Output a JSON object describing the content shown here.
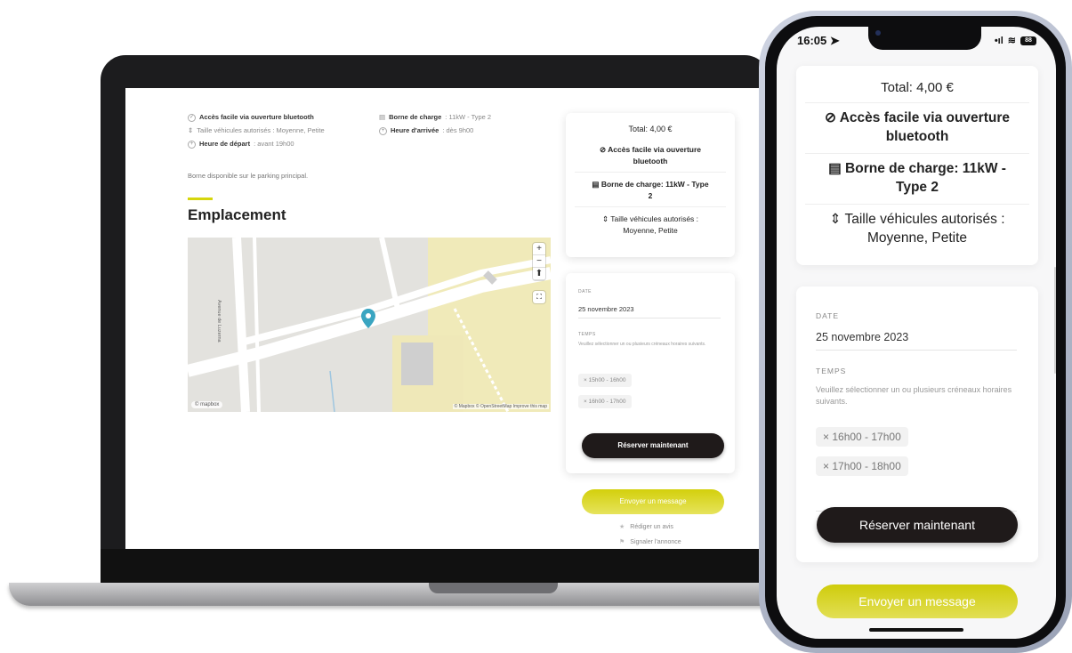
{
  "laptop": {
    "features": {
      "bluetooth": "Accès facile via ouverture bluetooth",
      "vehicle_size": "Taille véhicules autorisés : Moyenne, Petite",
      "departure_label": "Heure de départ",
      "departure_value": " : avant 19h00",
      "charging_label": "Borne de charge",
      "charging_value": ": 11kW - Type 2",
      "arrival_label": "Heure d'arrivée",
      "arrival_value": " : dès 9h00"
    },
    "description": "Borne disponible sur le parking principal.",
    "section_title": "Emplacement",
    "map": {
      "zoom_in": "+",
      "zoom_out": "−",
      "compass": "⬆",
      "fullscreen": "⛶",
      "street_label": "Avenue de Luzerna",
      "attribution": "© Mapbox © OpenStreetMap Improve this map",
      "logo": "© mapbox"
    },
    "summary": {
      "total": "Total: 4,00 €",
      "bluetooth": "⊘ Accès facile via ouverture bluetooth",
      "charging": "Borne de charge: 11kW - Type 2",
      "vehicle_size": "⇕ Taille véhicules autorisés : Moyenne, Petite"
    },
    "booking": {
      "date_label": "DATE",
      "date_value": "25 novembre 2023",
      "time_label": "TEMPS",
      "hint": "Veuillez sélectionner un ou plusieurs créneaux horaires suivants.",
      "slots": [
        "× 15h00 - 16h00",
        "× 16h00 - 17h00"
      ],
      "reserve_button": "Réserver maintenant"
    },
    "message_button": "Envoyer un message",
    "review_link": "Rédiger un avis",
    "report_link": "Signaler l'annonce"
  },
  "phone": {
    "status": {
      "time": "16:05",
      "signal": "•ıl",
      "wifi": "≋",
      "battery": "88"
    },
    "summary": {
      "total": "Total: 4,00 €",
      "bluetooth": "⊘ Accès facile via ouverture bluetooth",
      "charging": "Borne de charge: 11kW - Type 2",
      "vehicle_size": "⇕ Taille véhicules autorisés : Moyenne, Petite"
    },
    "booking": {
      "date_label": "DATE",
      "date_value": "25 novembre 2023",
      "time_label": "TEMPS",
      "hint": "Veuillez sélectionner un ou plusieurs créneaux horaires suivants.",
      "slots": [
        "× 16h00 - 17h00",
        "× 17h00 - 18h00"
      ],
      "reserve_button": "Réserver maintenant"
    },
    "message_button": "Envoyer un message"
  },
  "colors": {
    "accent": "#d6d60c",
    "dark_button": "#1f1a1a",
    "map_pin": "#3aa5c1"
  }
}
